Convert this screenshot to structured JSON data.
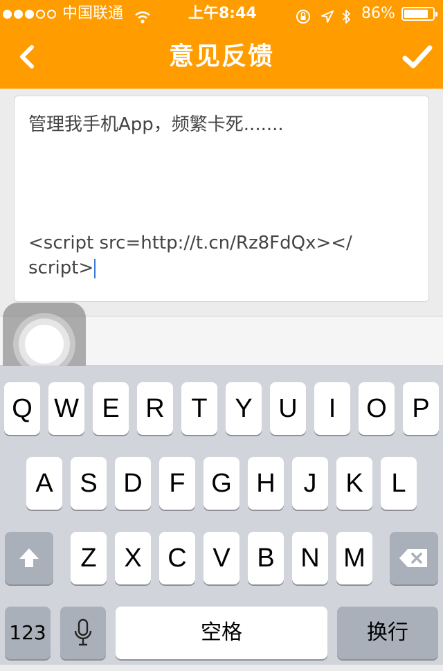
{
  "status_bar": {
    "carrier": "中国联通",
    "time": "上午8:44",
    "battery_percent": "86%",
    "battery_level": 0.86,
    "signal_bars": 3,
    "signal_total": 5
  },
  "nav": {
    "title": "意见反馈",
    "back_icon": "chevron-left-icon",
    "done_icon": "checkmark-icon"
  },
  "feedback": {
    "line1": "管理我手机App，频繁卡死.......",
    "code_text": "<script src=http://t.cn/Rz8FdQx></ script>"
  },
  "keyboard": {
    "row1": [
      "Q",
      "W",
      "E",
      "R",
      "T",
      "Y",
      "U",
      "I",
      "O",
      "P"
    ],
    "row2": [
      "A",
      "S",
      "D",
      "F",
      "G",
      "H",
      "J",
      "K",
      "L"
    ],
    "row3": [
      "Z",
      "X",
      "C",
      "V",
      "B",
      "N",
      "M"
    ],
    "numbers_label": "123",
    "space_label": "空格",
    "return_label": "换行",
    "shift_icon": "shift-arrow-icon",
    "delete_icon": "backspace-icon",
    "mic_icon": "microphone-icon"
  },
  "colors": {
    "header_bg": "#ff9c00",
    "caret": "#3b77d6"
  }
}
